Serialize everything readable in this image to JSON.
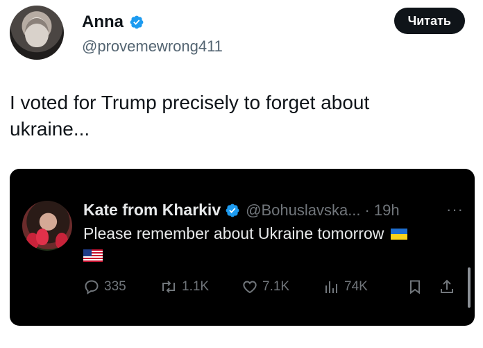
{
  "post": {
    "author_name": "Anna",
    "author_handle": "@provemewrong411",
    "read_button_label": "Читать",
    "text": "I voted for Trump precisely to forget about ukraine..."
  },
  "quote": {
    "author_name": "Kate from Kharkiv",
    "author_handle": "@Bohuslavska...",
    "separator": "·",
    "time": "19h",
    "more": "···",
    "text": "Please remember about Ukraine tomorrow",
    "flags": [
      "ukraine-flag-icon",
      "usa-flag-icon"
    ],
    "actions": {
      "replies": "335",
      "reposts": "1.1K",
      "likes": "7.1K",
      "views": "74K"
    }
  },
  "colors": {
    "verified_blue": "#1d9bf0",
    "text_primary": "#0f1419",
    "text_secondary": "#536471",
    "dark_card": "#000000",
    "dark_text": "#e7e9ea",
    "dark_muted": "#71767b"
  }
}
